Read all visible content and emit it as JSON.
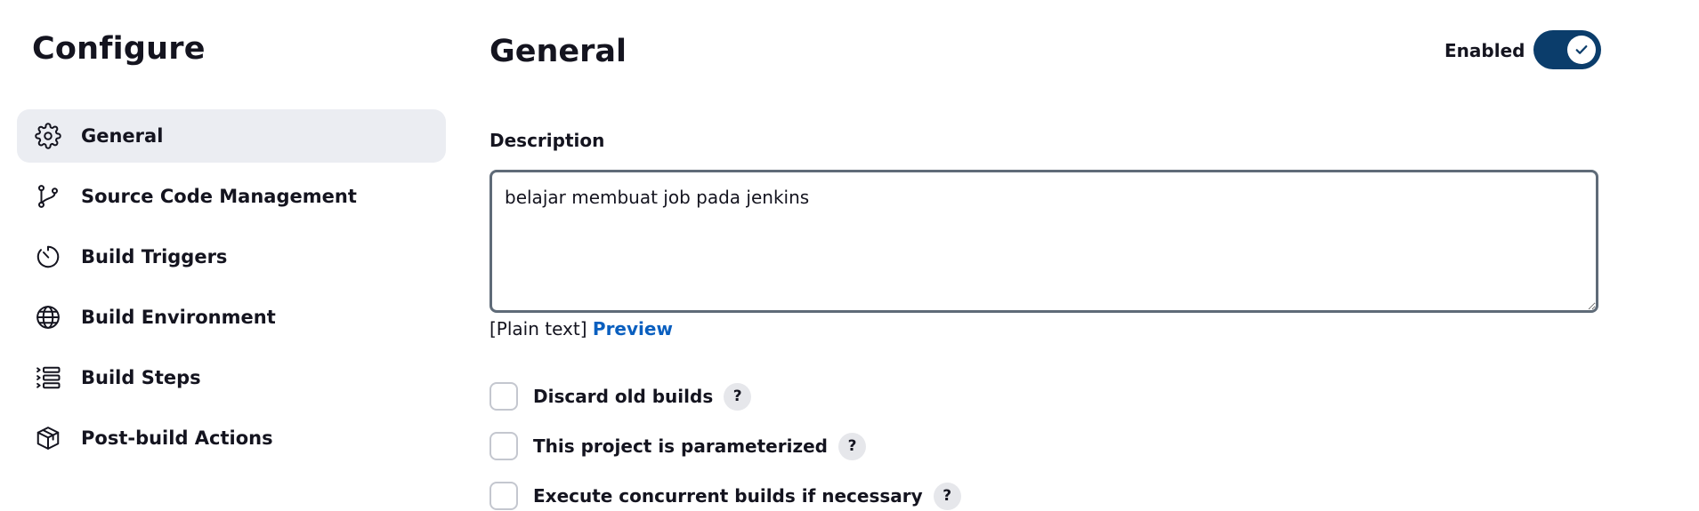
{
  "page": {
    "title": "Configure"
  },
  "sidebar": {
    "items": [
      {
        "label": "General",
        "icon": "gear-icon",
        "active": true
      },
      {
        "label": "Source Code Management",
        "icon": "git-branch-icon"
      },
      {
        "label": "Build Triggers",
        "icon": "timer-icon"
      },
      {
        "label": "Build Environment",
        "icon": "globe-icon"
      },
      {
        "label": "Build Steps",
        "icon": "list-steps-icon"
      },
      {
        "label": "Post-build Actions",
        "icon": "package-icon"
      }
    ]
  },
  "main": {
    "section_title": "General",
    "enabled": {
      "label": "Enabled",
      "checked": true,
      "icon": "check-icon"
    },
    "description": {
      "label": "Description",
      "value": "belajar membuat job pada jenkins",
      "format_prefix": "[Plain text]",
      "preview_label": "Preview"
    },
    "options": [
      {
        "label": "Discard old builds",
        "checked": false,
        "help": "?"
      },
      {
        "label": "This project is parameterized",
        "checked": false,
        "help": "?"
      },
      {
        "label": "Execute concurrent builds if necessary",
        "checked": false,
        "help": "?"
      }
    ]
  },
  "colors": {
    "toggle_on": "#0b3d6b",
    "nav_active_bg": "#ebedf2",
    "link": "#0a5fbf",
    "textarea_border": "#5f6b78"
  }
}
